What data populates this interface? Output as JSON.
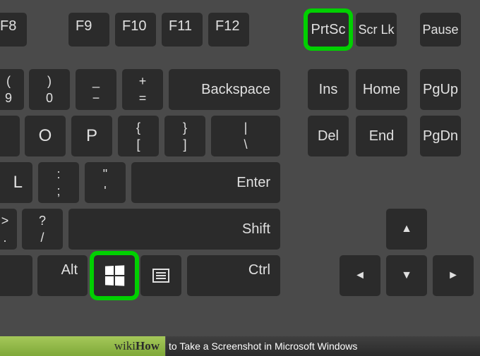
{
  "rows": {
    "function": {
      "f8": "F8",
      "f9": "F9",
      "f10": "F10",
      "f11": "F11",
      "f12": "F12",
      "prtsc": "PrtSc",
      "scrlk": "Scr Lk",
      "pause": "Pause"
    },
    "num": {
      "nine": {
        "top": "(",
        "bot": "9"
      },
      "zero": {
        "top": ")",
        "bot": "0"
      },
      "minus": {
        "top": "_",
        "bot": "−"
      },
      "equals": {
        "top": "+",
        "bot": "="
      },
      "backspace": "Backspace",
      "ins": "Ins",
      "home": "Home",
      "pgup": "PgUp"
    },
    "qwerty": {
      "o": "O",
      "p": "P",
      "lbracket": {
        "top": "{",
        "bot": "["
      },
      "rbracket": {
        "top": "}",
        "bot": "]"
      },
      "backslash": {
        "top": "|",
        "bot": "\\"
      },
      "del": "Del",
      "end": "End",
      "pgdn": "PgDn"
    },
    "home": {
      "l": "L",
      "semicolon": {
        "top": ":",
        "bot": ";"
      },
      "quote": {
        "top": "\"",
        "bot": "'"
      },
      "enter": "Enter"
    },
    "shift": {
      "period": {
        "top": ">",
        "bot": "."
      },
      "slash": {
        "top": "?",
        "bot": "/"
      },
      "shift": "Shift",
      "up": "▲"
    },
    "ctrl": {
      "alt": "Alt",
      "ctrl": "Ctrl",
      "left": "◄",
      "down": "▼",
      "right": "►"
    }
  },
  "caption": {
    "wiki": "wiki",
    "how": "How",
    "title": "to Take a Screenshot in Microsoft Windows"
  },
  "colors": {
    "highlight": "#00d000"
  }
}
